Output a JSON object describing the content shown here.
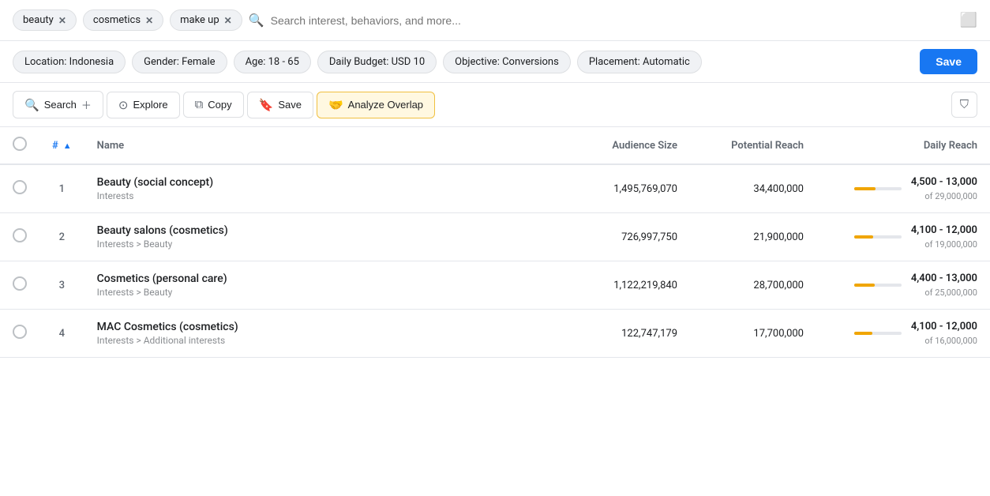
{
  "tags": [
    {
      "label": "beauty",
      "id": "beauty"
    },
    {
      "label": "cosmetics",
      "id": "cosmetics"
    },
    {
      "label": "make up",
      "id": "makeup"
    }
  ],
  "search": {
    "placeholder": "Search interest, behaviors, and more..."
  },
  "filters": [
    {
      "label": "Location: Indonesia",
      "key": "location"
    },
    {
      "label": "Gender: Female",
      "key": "gender"
    },
    {
      "label": "Age: 18 - 65",
      "key": "age"
    },
    {
      "label": "Daily Budget: USD 10",
      "key": "budget"
    },
    {
      "label": "Objective: Conversions",
      "key": "objective"
    },
    {
      "label": "Placement: Automatic",
      "key": "placement"
    }
  ],
  "save_top_label": "Save",
  "toolbar": {
    "search_label": "Search",
    "explore_label": "Explore",
    "copy_label": "Copy",
    "save_label": "Save",
    "analyze_label": "Analyze Overlap"
  },
  "table": {
    "headers": {
      "name": "Name",
      "audience": "Audience Size",
      "potential": "Potential Reach",
      "daily": "Daily Reach"
    },
    "rows": [
      {
        "num": "1",
        "name": "Beauty (social concept)",
        "sub": "Interests",
        "audience": "1,495,769,070",
        "potential": "34,400,000",
        "bar_pct": 45,
        "daily_range": "4,500 - 13,000",
        "daily_of": "of 29,000,000"
      },
      {
        "num": "2",
        "name": "Beauty salons (cosmetics)",
        "sub": "Interests > Beauty",
        "audience": "726,997,750",
        "potential": "21,900,000",
        "bar_pct": 40,
        "daily_range": "4,100 - 12,000",
        "daily_of": "of 19,000,000"
      },
      {
        "num": "3",
        "name": "Cosmetics (personal care)",
        "sub": "Interests > Beauty",
        "audience": "1,122,219,840",
        "potential": "28,700,000",
        "bar_pct": 43,
        "daily_range": "4,400 - 13,000",
        "daily_of": "of 25,000,000"
      },
      {
        "num": "4",
        "name": "MAC Cosmetics (cosmetics)",
        "sub": "Interests > Additional interests",
        "audience": "122,747,179",
        "potential": "17,700,000",
        "bar_pct": 38,
        "daily_range": "4,100 - 12,000",
        "daily_of": "of 16,000,000"
      }
    ]
  }
}
